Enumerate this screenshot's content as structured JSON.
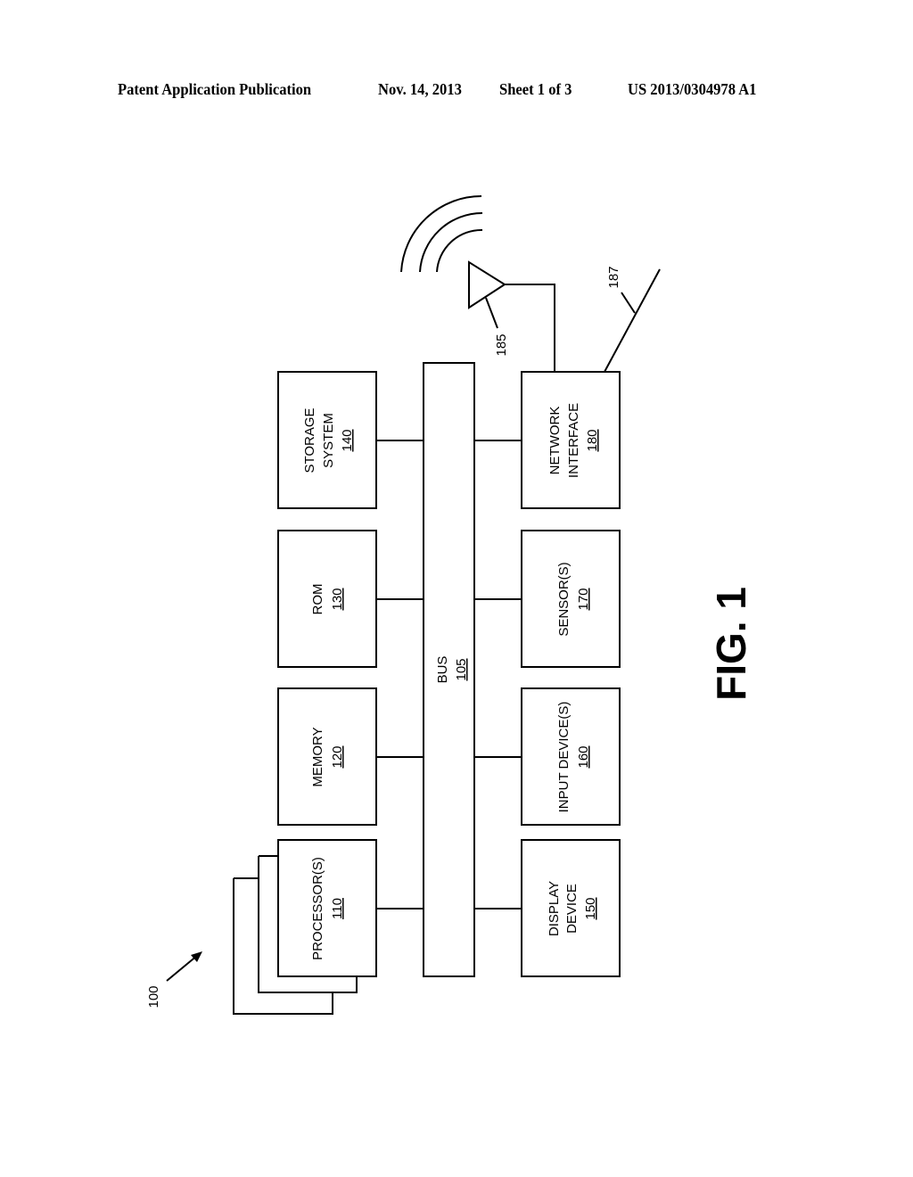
{
  "header": {
    "publication": "Patent Application Publication",
    "date": "Nov. 14, 2013",
    "sheet": "Sheet 1 of 3",
    "number": "US 2013/0304978 A1"
  },
  "figure": {
    "label": "FIG. 1",
    "system_ref": "100",
    "bus": {
      "name": "BUS",
      "ref": "105"
    },
    "blocks_left": [
      {
        "id": "processor",
        "lines": [
          "PROCESSOR(S)"
        ],
        "ref": "110"
      },
      {
        "id": "memory",
        "lines": [
          "MEMORY"
        ],
        "ref": "120"
      },
      {
        "id": "rom",
        "lines": [
          "ROM"
        ],
        "ref": "130"
      },
      {
        "id": "storage",
        "lines": [
          "STORAGE",
          "SYSTEM"
        ],
        "ref": "140"
      }
    ],
    "blocks_right": [
      {
        "id": "display",
        "lines": [
          "DISPLAY",
          "DEVICE"
        ],
        "ref": "150"
      },
      {
        "id": "input",
        "lines": [
          "INPUT DEVICE(S)"
        ],
        "ref": "160"
      },
      {
        "id": "sensor",
        "lines": [
          "SENSOR(S)"
        ],
        "ref": "170"
      },
      {
        "id": "network",
        "lines": [
          "NETWORK",
          "INTERFACE"
        ],
        "ref": "180"
      }
    ],
    "antenna_ref": "185",
    "wire_ref": "187"
  }
}
